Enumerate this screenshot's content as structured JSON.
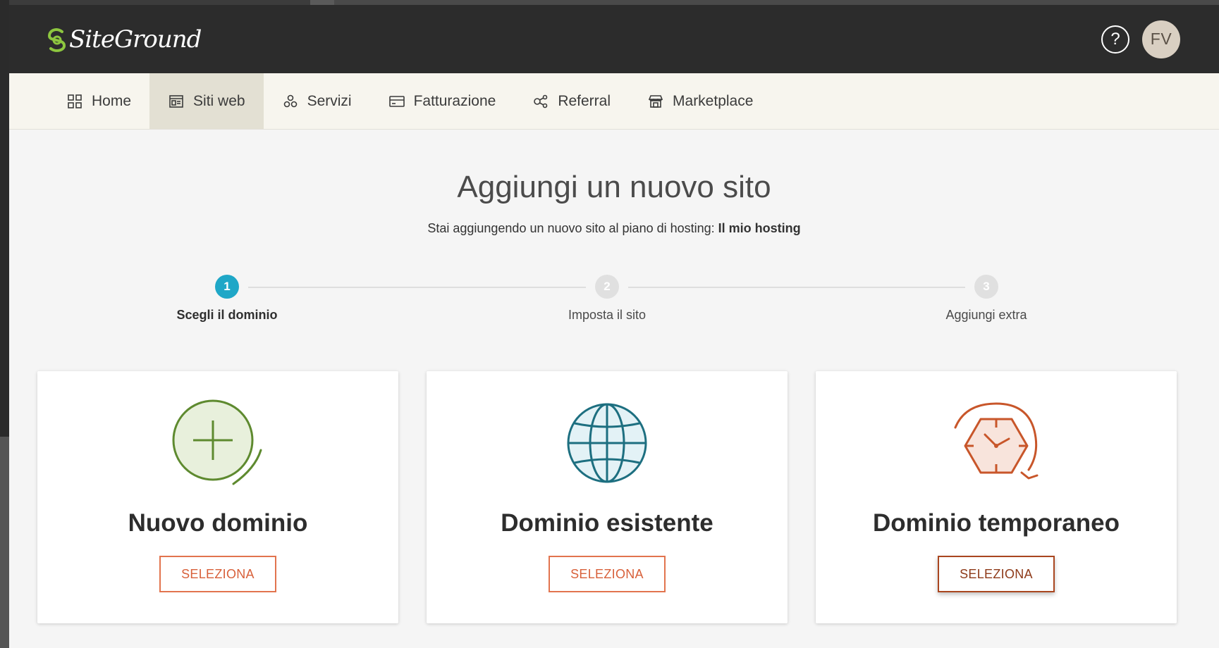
{
  "header": {
    "logo_text": "SiteGround",
    "help_icon": "question-circle-icon",
    "avatar_initials": "FV"
  },
  "nav": {
    "items": [
      {
        "label": "Home",
        "icon": "grid-icon"
      },
      {
        "label": "Siti web",
        "icon": "website-icon",
        "active": true
      },
      {
        "label": "Servizi",
        "icon": "services-icon"
      },
      {
        "label": "Fatturazione",
        "icon": "credit-card-icon"
      },
      {
        "label": "Referral",
        "icon": "share-icon"
      },
      {
        "label": "Marketplace",
        "icon": "store-icon"
      }
    ]
  },
  "page": {
    "title": "Aggiungi un nuovo sito",
    "subtitle_prefix": "Stai aggiungendo un nuovo sito al piano di hosting:",
    "subtitle_plan": "Il mio hosting"
  },
  "steps": [
    {
      "number": "1",
      "label": "Scegli il dominio",
      "active": true
    },
    {
      "number": "2",
      "label": "Imposta il sito"
    },
    {
      "number": "3",
      "label": "Aggiungi extra"
    }
  ],
  "cards": [
    {
      "title": "Nuovo dominio",
      "icon": "plus-circle-icon",
      "button": "SELEZIONA"
    },
    {
      "title": "Dominio esistente",
      "icon": "globe-icon",
      "button": "SELEZIONA"
    },
    {
      "title": "Dominio temporaneo",
      "icon": "clock-hexagon-icon",
      "button": "SELEZIONA"
    }
  ],
  "colors": {
    "header_bg": "#2c2c2c",
    "logo_green": "#8dc63f",
    "step_active": "#1fa7c7",
    "button_orange": "#e2744e",
    "green_icon": "#5e8a2f",
    "teal_icon": "#1d6f80",
    "orange_icon": "#c8562a"
  }
}
